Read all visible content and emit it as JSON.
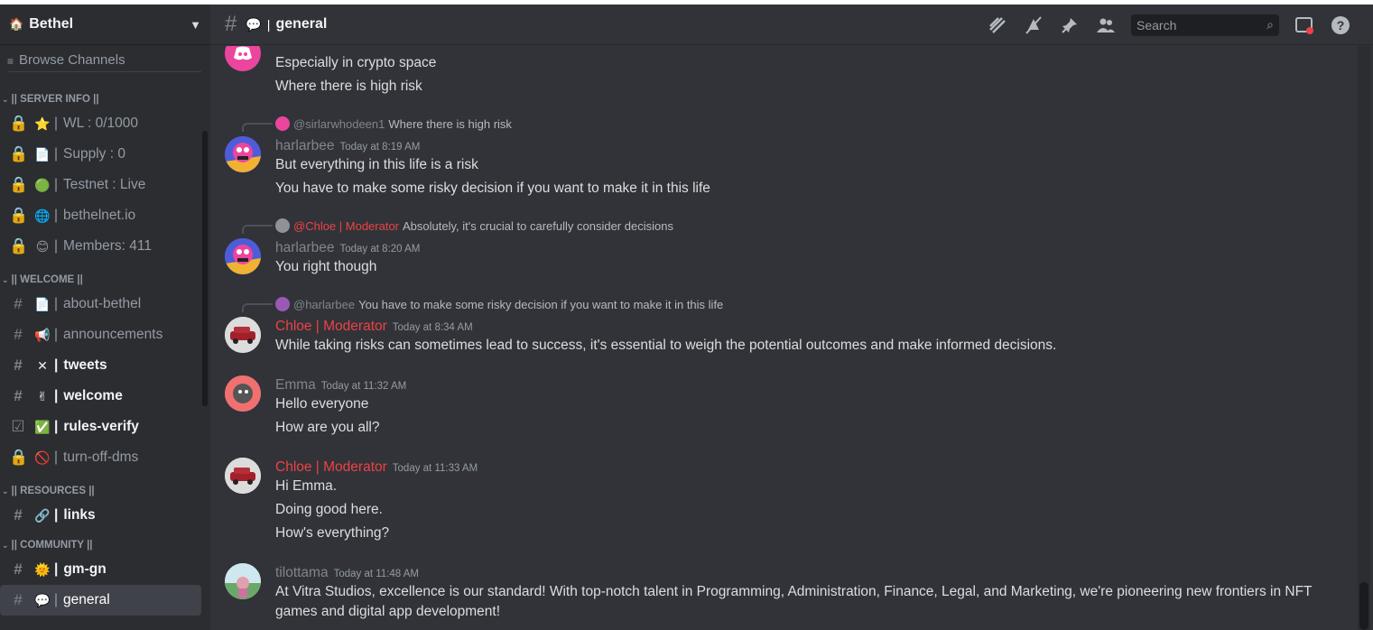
{
  "server": {
    "name": "Bethel",
    "icon": "house-icon"
  },
  "sidebar": {
    "browse_label": "Browse Channels",
    "categories": [
      {
        "label": "|| SERVER INFO ||"
      },
      {
        "label": "|| WELCOME ||"
      },
      {
        "label": "|| RESOURCES ||"
      },
      {
        "label": "|| COMMUNITY ||"
      }
    ],
    "channels": {
      "wl": {
        "emoji": "⭐",
        "name": "WL : 0/1000"
      },
      "supply": {
        "emoji": "📄",
        "name": "Supply : 0"
      },
      "testnet": {
        "emoji": "🟢",
        "name": "Testnet : Live"
      },
      "site": {
        "emoji": "🌐",
        "name": "bethelnet.io"
      },
      "members": {
        "emoji": "😊",
        "name": "Members: 411"
      },
      "about": {
        "emoji": "📄",
        "name": "about-bethel"
      },
      "announcements": {
        "emoji": "📢",
        "name": "announcements"
      },
      "tweets": {
        "emoji": "✕",
        "name": "tweets"
      },
      "welcome": {
        "emoji": "✌",
        "name": "welcome"
      },
      "rules": {
        "emoji": "✅",
        "name": "rules-verify"
      },
      "dms": {
        "emoji": "🚫",
        "name": "turn-off-dms"
      },
      "links": {
        "emoji": "🔗",
        "name": "links"
      },
      "gmgn": {
        "emoji": "🌞",
        "name": "gm-gn"
      },
      "general": {
        "emoji": "💬",
        "name": "general"
      }
    }
  },
  "header": {
    "channel_name": "general",
    "channel_emoji": "💬",
    "search_placeholder": "Search"
  },
  "messages": {
    "m0": {
      "lines": [
        "Especially in crypto space",
        "Where there is high risk"
      ]
    },
    "m1": {
      "reply_user": "@sirlarwhodeen1",
      "reply_text": "Where there is high risk",
      "user": "harlarbee",
      "time": "Today at 8:19 AM",
      "lines": [
        "But everything in this life is a risk",
        "You have to make some risky decision if you want to make it in this life"
      ]
    },
    "m2": {
      "reply_user": "@Chloe | Moderator",
      "reply_text": "Absolutely, it's crucial to carefully consider decisions",
      "user": "harlarbee",
      "time": "Today at 8:20 AM",
      "lines": [
        "You right though"
      ]
    },
    "m3": {
      "reply_user": "@harlarbee",
      "reply_text": "You have to make some risky decision if you want to make it in this life",
      "user": "Chloe | Moderator",
      "time": "Today at 8:34 AM",
      "lines": [
        "While taking risks can sometimes lead to success, it's essential to weigh the potential outcomes and make informed decisions."
      ]
    },
    "m4": {
      "user": "Emma",
      "time": "Today at 11:32 AM",
      "lines": [
        "Hello everyone",
        "How are you all?"
      ]
    },
    "m5": {
      "user": "Chloe | Moderator",
      "time": "Today at 11:33 AM",
      "lines": [
        "Hi Emma.",
        "Doing good here.",
        "How's everything?"
      ]
    },
    "m6": {
      "user": "tilottama",
      "time": "Today at 11:48 AM",
      "lines": [
        "At Vitra Studios, excellence is our standard! With top-notch talent in Programming, Administration, Finance, Legal, and Marketing, we're pioneering new frontiers in NFT games and digital app development!"
      ]
    }
  },
  "colors": {
    "moderator": "#ed4245",
    "background": "#313338",
    "sidebar": "#2b2d31"
  }
}
